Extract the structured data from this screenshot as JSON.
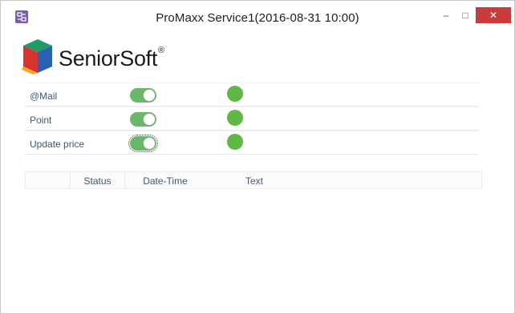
{
  "window": {
    "title": "ProMaxx Service1(2016-08-31 10:00)",
    "icons": {
      "app": "app-icon",
      "minimize": "minimize-icon",
      "maximize": "maximize-icon",
      "close": "close-icon"
    },
    "controls": {
      "minimize": "–",
      "maximize": "□",
      "close": "✕"
    },
    "close_color": "#c83c3c"
  },
  "brand": {
    "name": "SeniorSoft",
    "trademark": "®"
  },
  "settings": [
    {
      "label": "@Mail",
      "enabled": true,
      "status_color": "#5fb843"
    },
    {
      "label": "Point",
      "enabled": true,
      "status_color": "#5fb843"
    },
    {
      "label": "Update price",
      "enabled": true,
      "status_color": "#5fb843"
    }
  ],
  "log_table": {
    "columns": [
      "",
      "Status",
      "Date-Time",
      "Text"
    ],
    "rows": []
  },
  "colors": {
    "toggle_on": "#69b76a",
    "label_text": "#3d5a73"
  }
}
